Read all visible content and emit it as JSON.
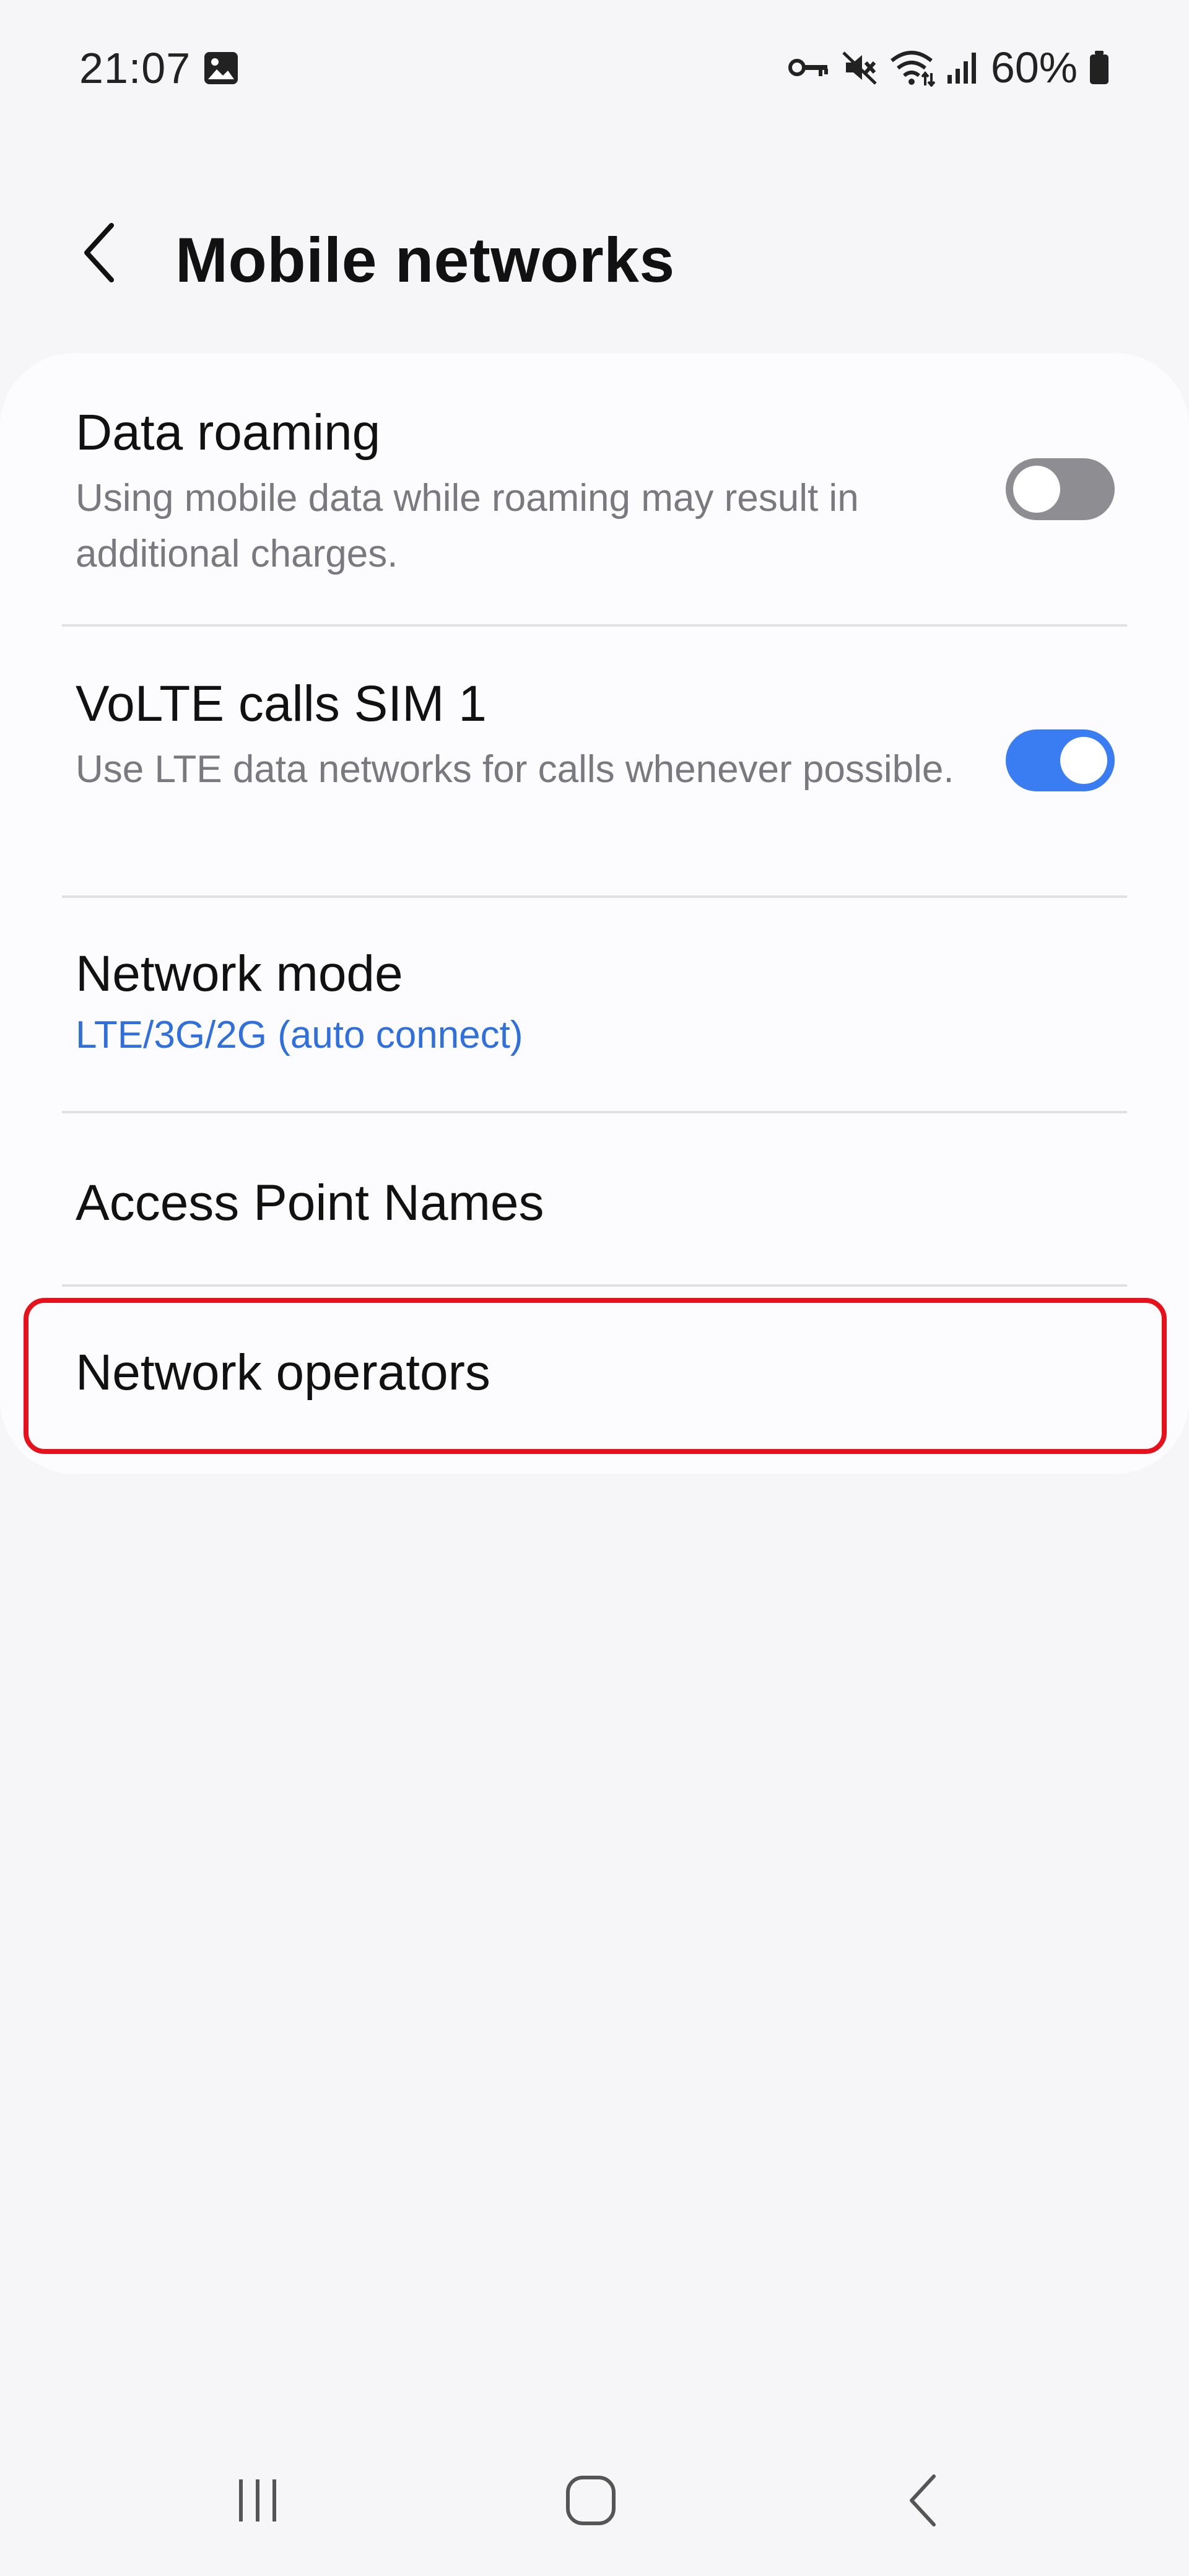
{
  "status_bar": {
    "time": "21:07",
    "battery_percent": "60%",
    "icons": [
      "gallery-icon",
      "vpn-key-icon",
      "mute-icon",
      "wifi-icon",
      "signal-icon",
      "battery-icon"
    ]
  },
  "header": {
    "title": "Mobile networks",
    "back_icon": "chevron-left-icon"
  },
  "settings": {
    "data_roaming": {
      "title": "Data roaming",
      "subtitle": "Using mobile data while roaming may result in additional charges.",
      "enabled": false
    },
    "volte": {
      "title": "VoLTE calls SIM 1",
      "subtitle": "Use LTE data networks for calls whenever possible.",
      "enabled": true
    },
    "network_mode": {
      "title": "Network mode",
      "value": "LTE/3G/2G (auto connect)"
    },
    "apn": {
      "title": "Access Point Names"
    },
    "network_operators": {
      "title": "Network operators",
      "highlighted": true
    }
  },
  "nav_bar": {
    "buttons": [
      "recent-apps-icon",
      "home-icon",
      "back-icon"
    ]
  },
  "colors": {
    "accent": "#3a7cf2",
    "link": "#2f6fde",
    "highlight": "#e8101a",
    "background": "#f6f6f8",
    "card": "#fcfcfe"
  }
}
